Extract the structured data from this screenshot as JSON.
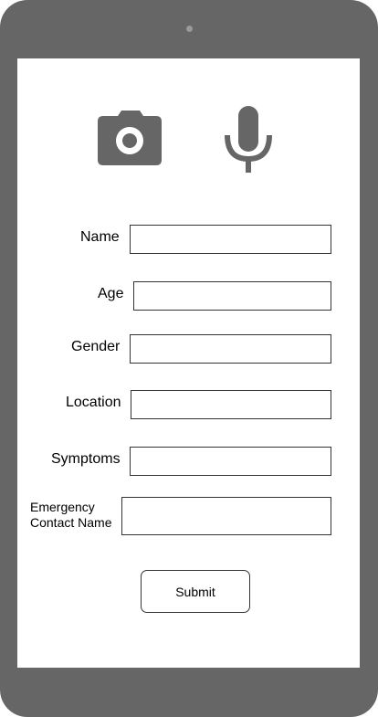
{
  "media_icons": {
    "camera": "camera-icon",
    "microphone": "microphone-icon"
  },
  "form": {
    "fields": [
      {
        "label": "Name",
        "value": "",
        "placeholder": ""
      },
      {
        "label": "Age",
        "value": "",
        "placeholder": ""
      },
      {
        "label": "Gender",
        "value": "",
        "placeholder": ""
      },
      {
        "label": "Location",
        "value": "",
        "placeholder": ""
      },
      {
        "label": "Symptoms",
        "value": "",
        "placeholder": ""
      },
      {
        "label": "Emergency Contact Name",
        "value": "",
        "placeholder": ""
      }
    ],
    "submit_label": "Submit"
  },
  "colors": {
    "device_frame": "#666666",
    "screen": "#ffffff",
    "border": "#333333",
    "icon": "#666666"
  }
}
